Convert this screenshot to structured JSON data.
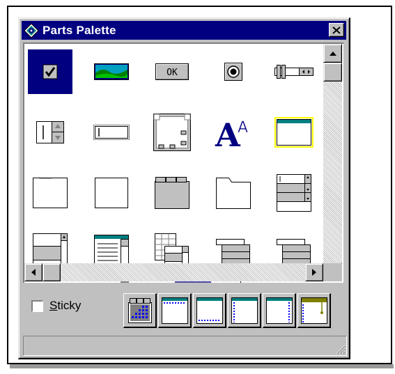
{
  "window": {
    "title": "Parts Palette"
  },
  "parts": {
    "ok_button_label": "OK",
    "font_part_glyphs": "AA",
    "items": [
      "checkbox-part",
      "picture-part",
      "button-part",
      "radio-button-part",
      "slider-part",
      "spin-field-part",
      "text-field-part",
      "panel-part",
      "font-part",
      "window-part",
      "page-part",
      "square-part",
      "folder-part",
      "tab-part",
      "list-box-part",
      "grid-part",
      "text-box-part",
      "multi-grid-part",
      "stacked-list-part",
      "stacked-list-2-part"
    ]
  },
  "sticky": {
    "label": "Sticky",
    "checked": false
  },
  "tools": [
    "grid-window-tool",
    "dotted-title-tool",
    "dotted-bottom-tool",
    "dotted-left-tool",
    "dotted-right-tool",
    "gauge-tool"
  ],
  "colors": {
    "titlebar": "#000080",
    "selection": "#000080",
    "teal": "#008080",
    "yellow": "#ffff00"
  }
}
